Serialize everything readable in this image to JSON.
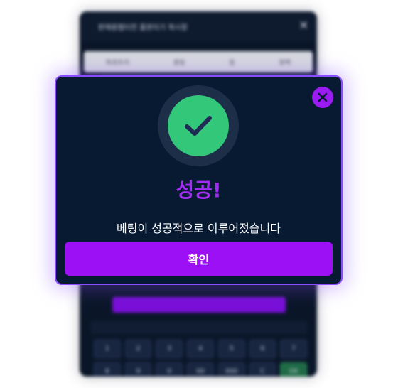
{
  "modal": {
    "title": "성공!",
    "message": "베팅이 성공적으로 이루어졌습니다",
    "confirm_label": "확인",
    "icon": "check-icon",
    "close_icon": "close-icon"
  },
  "background": {
    "header_text": "판매용펌터전 홈판이기 북시장",
    "tabs": [
      "파로트리",
      "홍팀",
      "동",
      "원택"
    ],
    "keys": [
      "1",
      "2",
      "3",
      "4",
      "5",
      "6",
      "7",
      "8",
      "9",
      "0",
      "00",
      "000",
      "C",
      "OK"
    ]
  },
  "colors": {
    "accent": "#9b10f5",
    "title": "#a52cf5",
    "success": "#33c77a",
    "modal_bg": "#071a32",
    "border": "#8a4cff"
  }
}
